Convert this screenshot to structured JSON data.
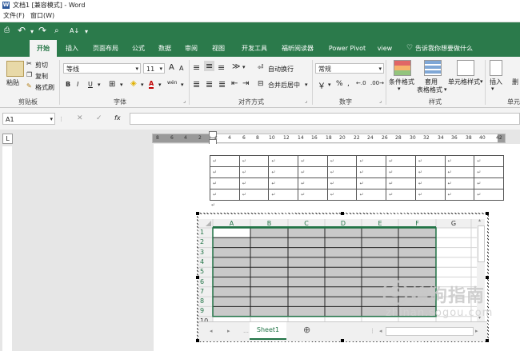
{
  "titlebar": {
    "title": "文档1 [兼容模式] - Word"
  },
  "menubar": {
    "items": [
      "文件(F)",
      "窗口(W)"
    ]
  },
  "qat": {
    "save": "⎙",
    "undo": "↶",
    "redo": "↷",
    "preview": "⌕",
    "sort": "A↓",
    "more": "▾"
  },
  "tabs": [
    "开始",
    "插入",
    "页面布局",
    "公式",
    "数据",
    "审阅",
    "视图",
    "开发工具",
    "福昕阅读器",
    "Power Pivot",
    "view",
    "告诉我你想要做什么"
  ],
  "ribbon": {
    "clipboard": {
      "paste": "粘贴",
      "cut": "剪切",
      "copy": "复制",
      "format_painter": "格式刷",
      "label": "剪贴板"
    },
    "font": {
      "name": "等线",
      "size": "11",
      "label": "字体",
      "bold": "B",
      "italic": "I",
      "underline": "U",
      "grow": "A",
      "shrink": "A",
      "color": "A",
      "wen": "wén"
    },
    "alignment": {
      "wrap": "自动换行",
      "merge": "合并后居中",
      "label": "对齐方式"
    },
    "number": {
      "format": "常规",
      "percent": "%",
      "comma": ",",
      "label": "数字"
    },
    "styles": {
      "conditional": "条件格式",
      "table": "套用",
      "table2": "表格格式",
      "cell": "单元格样式",
      "label": "样式"
    },
    "cells": {
      "insert": "插入",
      "delete": "删",
      "label": "单元"
    }
  },
  "formula": {
    "namebox": "A1",
    "fx": "fx",
    "cancel": "✕",
    "enter": "✓"
  },
  "ruler": {
    "marks": [
      "8",
      "6",
      "4",
      "2",
      "2",
      "4",
      "6",
      "8",
      "10",
      "12",
      "14",
      "16",
      "18",
      "20",
      "22",
      "24",
      "26",
      "28",
      "30",
      "32",
      "34",
      "36",
      "38",
      "40",
      "42"
    ]
  },
  "word_table": {
    "rows": 4,
    "cols": 10,
    "mark": "↵"
  },
  "para_mark": "↵",
  "sheet": {
    "columns": [
      "A",
      "B",
      "C",
      "D",
      "E",
      "F",
      "G"
    ],
    "rows": [
      "1",
      "2",
      "3",
      "4",
      "5",
      "6",
      "7",
      "8",
      "9",
      "10"
    ],
    "tab": "Sheet1",
    "add": "⊕"
  },
  "watermark": {
    "text": "搜狗指南",
    "url": "zhinan.sogou.com"
  },
  "colors": {
    "accent": "#2b7a4b",
    "gray_cell": "#c9c9c9",
    "selection": "#217346"
  }
}
